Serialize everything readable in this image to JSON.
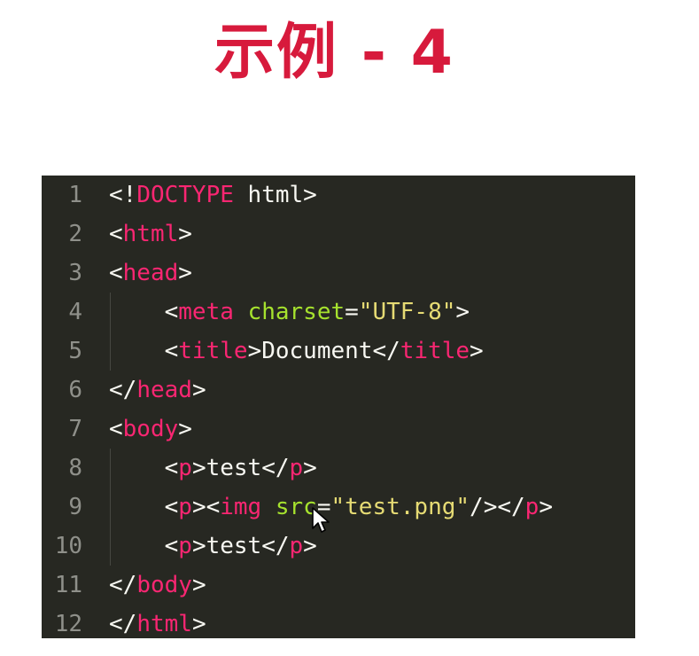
{
  "slide": {
    "title": "示例 - 4"
  },
  "editor": {
    "colors": {
      "background": "#272822",
      "gutter": "#8f908a",
      "punct": "#f8f8f2",
      "tag": "#f92672",
      "attr": "#a6e22e",
      "string": "#e6db74",
      "text": "#f8f8f2"
    },
    "lines": [
      {
        "number": "1",
        "indent": "",
        "tokens": [
          {
            "text": "<!",
            "kind": "punct"
          },
          {
            "text": "DOCTYPE",
            "kind": "tag"
          },
          {
            "text": " html>",
            "kind": "text"
          }
        ]
      },
      {
        "number": "2",
        "indent": "",
        "tokens": [
          {
            "text": "<",
            "kind": "punct"
          },
          {
            "text": "html",
            "kind": "tag"
          },
          {
            "text": ">",
            "kind": "punct"
          }
        ]
      },
      {
        "number": "3",
        "indent": "",
        "tokens": [
          {
            "text": "<",
            "kind": "punct"
          },
          {
            "text": "head",
            "kind": "tag"
          },
          {
            "text": ">",
            "kind": "punct"
          }
        ]
      },
      {
        "number": "4",
        "indent": "    ",
        "tokens": [
          {
            "text": "<",
            "kind": "punct"
          },
          {
            "text": "meta",
            "kind": "tag"
          },
          {
            "text": " ",
            "kind": "text"
          },
          {
            "text": "charset",
            "kind": "attr"
          },
          {
            "text": "=",
            "kind": "punct"
          },
          {
            "text": "\"UTF-8\"",
            "kind": "string"
          },
          {
            "text": ">",
            "kind": "punct"
          }
        ]
      },
      {
        "number": "5",
        "indent": "    ",
        "tokens": [
          {
            "text": "<",
            "kind": "punct"
          },
          {
            "text": "title",
            "kind": "tag"
          },
          {
            "text": ">Document</",
            "kind": "text"
          },
          {
            "text": "title",
            "kind": "tag"
          },
          {
            "text": ">",
            "kind": "punct"
          }
        ]
      },
      {
        "number": "6",
        "indent": "",
        "tokens": [
          {
            "text": "</",
            "kind": "punct"
          },
          {
            "text": "head",
            "kind": "tag"
          },
          {
            "text": ">",
            "kind": "punct"
          }
        ]
      },
      {
        "number": "7",
        "indent": "",
        "tokens": [
          {
            "text": "<",
            "kind": "punct"
          },
          {
            "text": "body",
            "kind": "tag"
          },
          {
            "text": ">",
            "kind": "punct"
          }
        ]
      },
      {
        "number": "8",
        "indent": "    ",
        "tokens": [
          {
            "text": "<",
            "kind": "punct"
          },
          {
            "text": "p",
            "kind": "tag"
          },
          {
            "text": ">test</",
            "kind": "text"
          },
          {
            "text": "p",
            "kind": "tag"
          },
          {
            "text": ">",
            "kind": "punct"
          }
        ]
      },
      {
        "number": "9",
        "indent": "    ",
        "tokens": [
          {
            "text": "<",
            "kind": "punct"
          },
          {
            "text": "p",
            "kind": "tag"
          },
          {
            "text": "><",
            "kind": "punct"
          },
          {
            "text": "img",
            "kind": "tag"
          },
          {
            "text": " ",
            "kind": "text"
          },
          {
            "text": "src",
            "kind": "attr"
          },
          {
            "text": "=",
            "kind": "punct"
          },
          {
            "text": "\"test.png\"",
            "kind": "string"
          },
          {
            "text": "/></",
            "kind": "punct"
          },
          {
            "text": "p",
            "kind": "tag"
          },
          {
            "text": ">",
            "kind": "punct"
          }
        ]
      },
      {
        "number": "10",
        "indent": "    ",
        "tokens": [
          {
            "text": "<",
            "kind": "punct"
          },
          {
            "text": "p",
            "kind": "tag"
          },
          {
            "text": ">test</",
            "kind": "text"
          },
          {
            "text": "p",
            "kind": "tag"
          },
          {
            "text": ">",
            "kind": "punct"
          }
        ]
      },
      {
        "number": "11",
        "indent": "",
        "tokens": [
          {
            "text": "</",
            "kind": "punct"
          },
          {
            "text": "body",
            "kind": "tag"
          },
          {
            "text": ">",
            "kind": "punct"
          }
        ]
      },
      {
        "number": "12",
        "indent": "",
        "tokens": [
          {
            "text": "</",
            "kind": "punct"
          },
          {
            "text": "html",
            "kind": "tag"
          },
          {
            "text": ">",
            "kind": "punct"
          }
        ]
      }
    ],
    "cursor": {
      "icon": "mouse-pointer-icon"
    }
  }
}
